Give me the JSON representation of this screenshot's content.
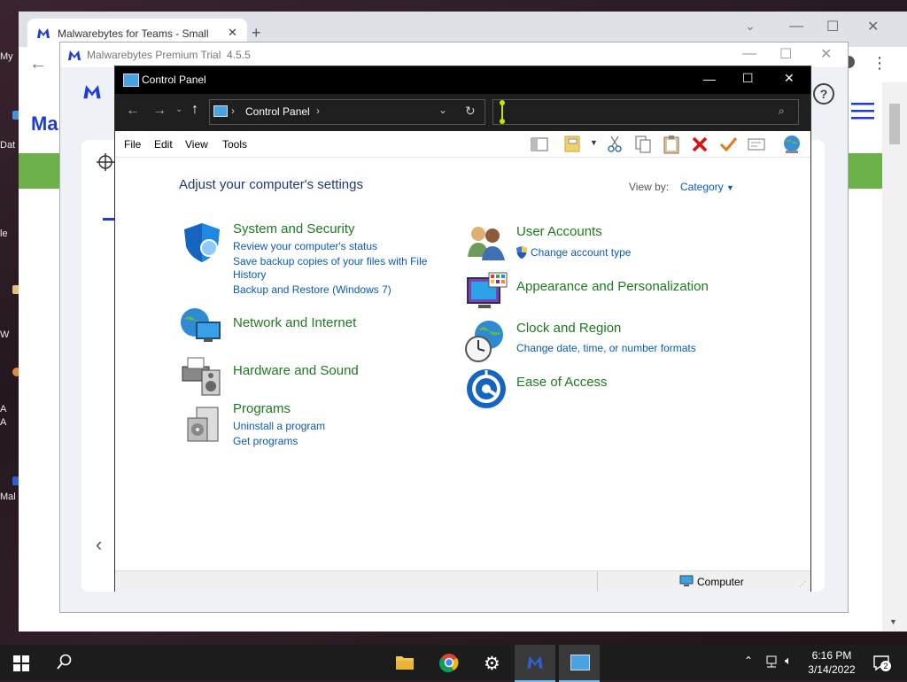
{
  "desktop": {
    "icons": [
      {
        "label": "My",
        "color": ""
      },
      {
        "label": "Dat",
        "color": "#4a90d9"
      },
      {
        "label": "le",
        "color": ""
      },
      {
        "label": "W",
        "color": "#e5c07b"
      },
      {
        "label": "A",
        "color": "#e08a3c"
      },
      {
        "label": "A",
        "color": ""
      },
      {
        "label": "Mal",
        "color": "#2f5fd0"
      }
    ]
  },
  "chrome": {
    "tab_title": "Malwarebytes for Teams - Small",
    "new_tab": "+",
    "win_min": "—",
    "win_max": "☐",
    "win_close": "✕"
  },
  "malwarebytes": {
    "title": "Malwarebytes Premium Trial",
    "version": "4.5.5",
    "help": "?"
  },
  "control_panel": {
    "title": "Control Panel",
    "address": "Control Panel",
    "menu": [
      "File",
      "Edit",
      "View",
      "Tools"
    ],
    "heading": "Adjust your computer's settings",
    "view_by_label": "View by:",
    "view_by_value": "Category",
    "categories_left": [
      {
        "title": "System and Security",
        "links": [
          "Review your computer's status",
          "Save backup copies of your files with File",
          "History",
          "Backup and Restore (Windows 7)"
        ]
      },
      {
        "title": "Network and Internet",
        "links": []
      },
      {
        "title": "Hardware and Sound",
        "links": []
      },
      {
        "title": "Programs",
        "links": [
          "Uninstall a program",
          "Get programs"
        ]
      }
    ],
    "categories_right": [
      {
        "title": "User Accounts",
        "links": [
          "Change account type"
        ]
      },
      {
        "title": "Appearance and Personalization",
        "links": []
      },
      {
        "title": "Clock and Region",
        "links": [
          "Change date, time, or number formats"
        ]
      },
      {
        "title": "Ease of Access",
        "links": []
      }
    ],
    "status_computer": "Computer"
  },
  "taskbar": {
    "time": "6:16 PM",
    "date": "3/14/2022",
    "notification_count": "2"
  }
}
